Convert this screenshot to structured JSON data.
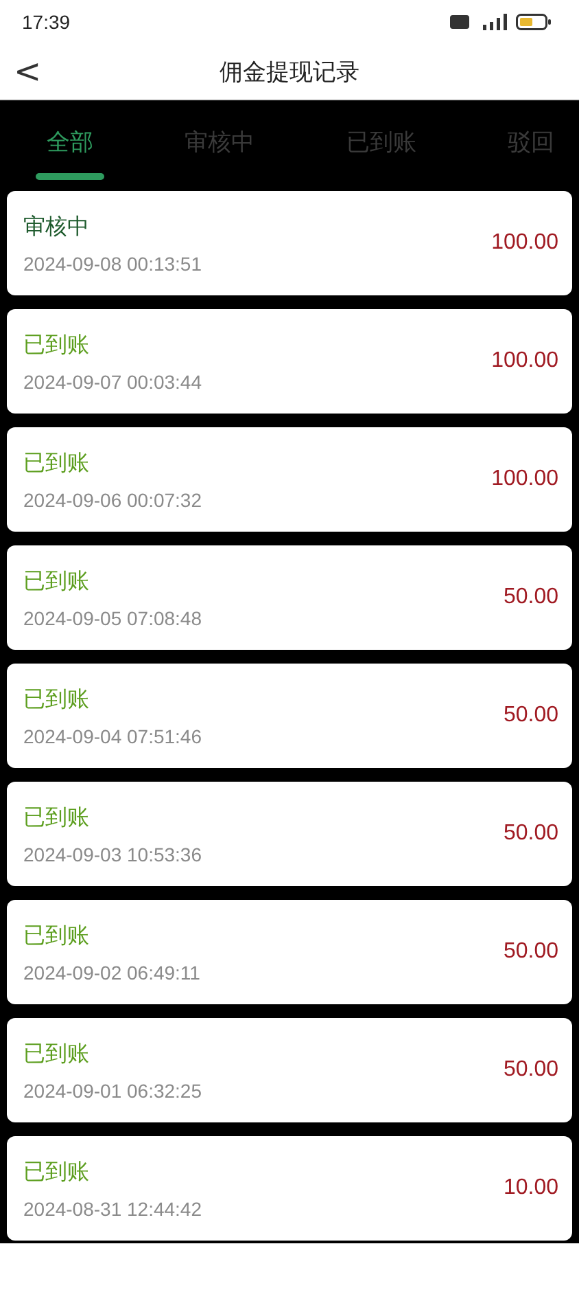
{
  "status_bar": {
    "time": "17:39"
  },
  "header": {
    "back": "<",
    "title": "佣金提现记录"
  },
  "tabs": [
    {
      "label": "全部",
      "selected": true
    },
    {
      "label": "审核中",
      "selected": false
    },
    {
      "label": "已到账",
      "selected": false
    },
    {
      "label": "驳回",
      "selected": false
    }
  ],
  "records": [
    {
      "status": "审核中",
      "kind": "pending",
      "time": "2024-09-08 00:13:51",
      "amount": "100.00"
    },
    {
      "status": "已到账",
      "kind": "paid",
      "time": "2024-09-07 00:03:44",
      "amount": "100.00"
    },
    {
      "status": "已到账",
      "kind": "paid",
      "time": "2024-09-06 00:07:32",
      "amount": "100.00"
    },
    {
      "status": "已到账",
      "kind": "paid",
      "time": "2024-09-05 07:08:48",
      "amount": "50.00"
    },
    {
      "status": "已到账",
      "kind": "paid",
      "time": "2024-09-04 07:51:46",
      "amount": "50.00"
    },
    {
      "status": "已到账",
      "kind": "paid",
      "time": "2024-09-03 10:53:36",
      "amount": "50.00"
    },
    {
      "status": "已到账",
      "kind": "paid",
      "time": "2024-09-02 06:49:11",
      "amount": "50.00"
    },
    {
      "status": "已到账",
      "kind": "paid",
      "time": "2024-09-01 06:32:25",
      "amount": "50.00"
    },
    {
      "status": "已到账",
      "kind": "paid",
      "time": "2024-08-31 12:44:42",
      "amount": "10.00"
    }
  ]
}
